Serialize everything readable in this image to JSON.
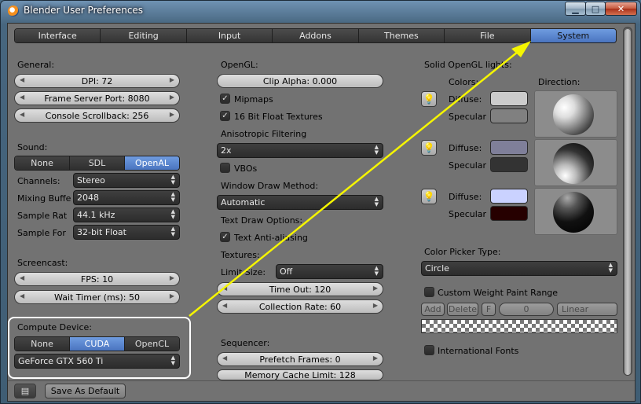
{
  "window": {
    "title": "Blender User Preferences",
    "minimize": "▁",
    "maximize": "□",
    "close": "✕"
  },
  "tabs": [
    "Interface",
    "Editing",
    "Input",
    "Addons",
    "Themes",
    "File",
    "System"
  ],
  "active_tab": "System",
  "general": {
    "heading": "General:",
    "dpi": "DPI: 72",
    "frame_server_port": "Frame Server Port: 8080",
    "console_scrollback": "Console Scrollback: 256"
  },
  "sound": {
    "heading": "Sound:",
    "options": [
      "None",
      "SDL",
      "OpenAL"
    ],
    "selected": "OpenAL",
    "channels_label": "Channels:",
    "channels_value": "Stereo",
    "mixing_label": "Mixing Buffe",
    "mixing_value": "2048",
    "sample_rate_label": "Sample Rat",
    "sample_rate_value": "44.1 kHz",
    "sample_format_label": "Sample For",
    "sample_format_value": "32-bit Float"
  },
  "screencast": {
    "heading": "Screencast:",
    "fps": "FPS: 10",
    "wait_timer": "Wait Timer (ms): 50"
  },
  "compute": {
    "heading": "Compute Device:",
    "options": [
      "None",
      "CUDA",
      "OpenCL"
    ],
    "selected": "CUDA",
    "device": "GeForce GTX 560 Ti"
  },
  "opengl": {
    "heading": "OpenGL:",
    "clip_alpha": "Clip Alpha: 0.000",
    "mipmaps": "Mipmaps",
    "mipmaps_checked": true,
    "float_textures": "16 Bit Float Textures",
    "float_textures_checked": true,
    "anisotropic_label": "Anisotropic Filtering",
    "anisotropic_value": "2x",
    "vbos": "VBOs",
    "vbos_checked": false,
    "window_draw_label": "Window Draw Method:",
    "window_draw_value": "Automatic",
    "text_draw_label": "Text Draw Options:",
    "text_antialiasing": "Text Anti-aliasing",
    "text_antialiasing_checked": true,
    "textures_label": "Textures:",
    "limit_size_label": "Limit Size:",
    "limit_size_value": "Off",
    "time_out": "Time Out: 120",
    "collection_rate": "Collection Rate: 60"
  },
  "sequencer": {
    "heading": "Sequencer:",
    "prefetch": "Prefetch Frames: 0",
    "memory_cache": "Memory Cache Limit: 128"
  },
  "solid_lights": {
    "heading": "Solid OpenGL lights:",
    "colors_label": "Colors:",
    "direction_label": "Direction:",
    "diffuse_label": "Diffuse:",
    "specular_label": "Specular",
    "lights": [
      {
        "diffuse": "#cccccc",
        "specular": "#808080"
      },
      {
        "diffuse": "#7f7f99",
        "specular": "#333333"
      },
      {
        "diffuse": "#cad2ff",
        "specular": "#260000"
      }
    ]
  },
  "color_picker": {
    "label": "Color Picker Type:",
    "value": "Circle"
  },
  "weight_paint": {
    "label": "Custom Weight Paint Range",
    "add": "Add",
    "delete": "Delete",
    "f": "F",
    "value": "0",
    "interp": "Linear"
  },
  "international_fonts": "International Fonts",
  "save_default": "Save As Default",
  "colors": {
    "accent": "#5b86d1",
    "arrow": "#f5f500"
  }
}
